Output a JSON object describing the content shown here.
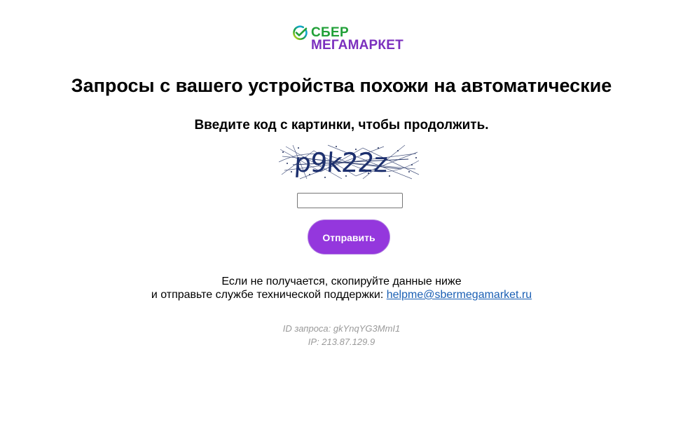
{
  "brand": {
    "line1": "СБЕР",
    "line2": "МЕГАМАРКЕТ",
    "green": "#21a038",
    "purple": "#7b2fbe",
    "icon": "sber-check-icon"
  },
  "title": "Запросы с вашего устройства похожи на автоматические",
  "subtitle": "Введите код с картинки, чтобы продолжить.",
  "captcha": {
    "text": "p9k22z",
    "input_value": "",
    "input_placeholder": ""
  },
  "submit": {
    "label": "Отправить",
    "color": "#9437dd"
  },
  "help": {
    "line1": "Если не получается, скопируйте данные ниже",
    "line2_prefix": "и отправьте службе технической поддержки: ",
    "email": "helpme@sbermegamarket.ru",
    "link_color": "#1a5fb4"
  },
  "meta": {
    "request_id": "ID запроса: gkYnqYG3MmI1",
    "ip": "IP: 213.87.129.9"
  }
}
